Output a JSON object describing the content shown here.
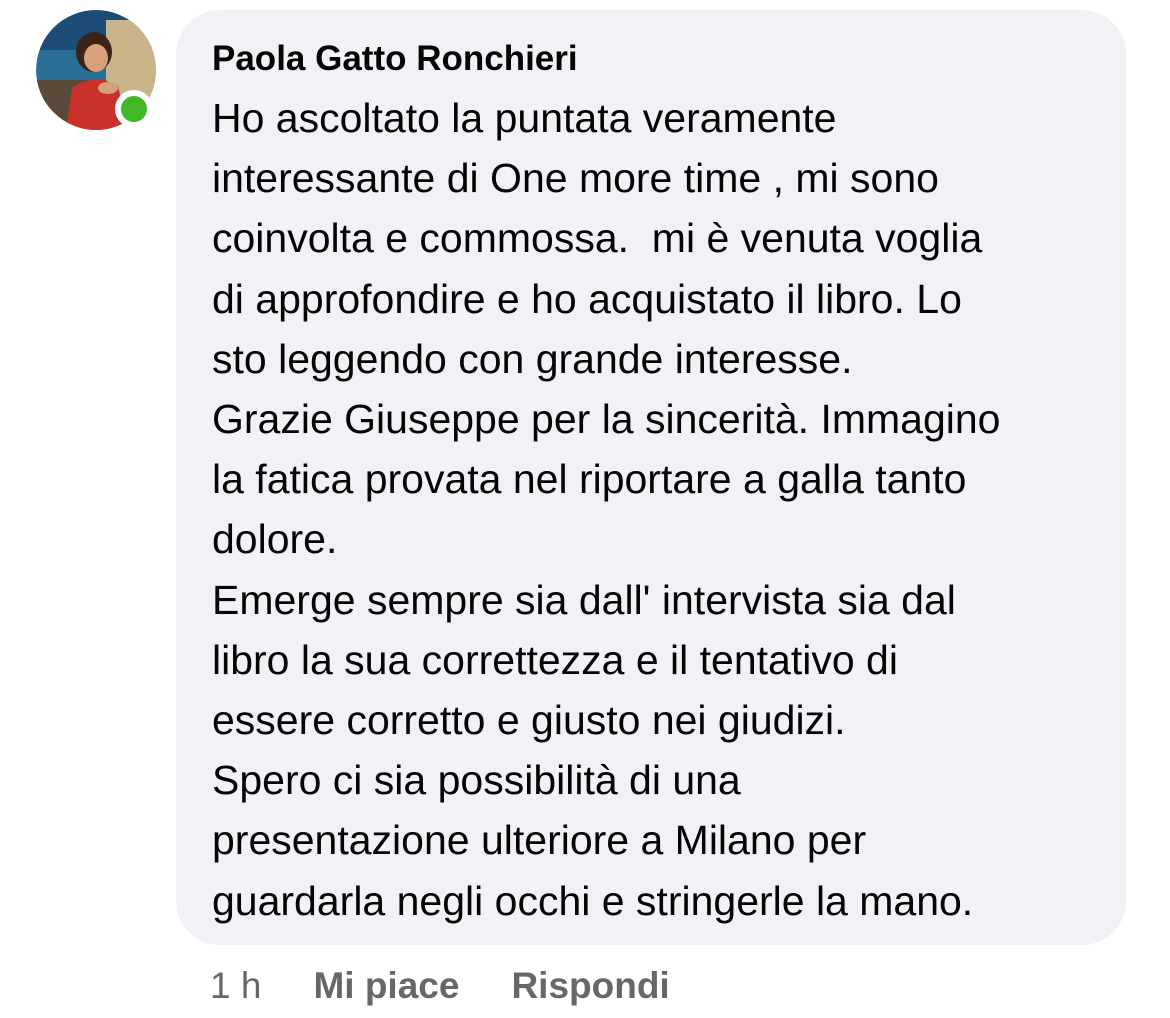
{
  "comment": {
    "author": "Paola Gatto Ronchieri",
    "lines": [
      "Ho ascoltato la puntata veramente",
      "interessante di One more time , mi sono",
      "coinvolta e commossa.  mi è venuta voglia",
      "di approfondire e ho acquistato il libro. Lo",
      "sto leggendo con grande interesse.",
      "Grazie Giuseppe per la sincerità. Immagino",
      "la fatica provata nel riportare a galla tanto",
      "dolore.",
      "Emerge sempre sia dall' intervista sia dal",
      "libro la sua correttezza e il tentativo di",
      "essere corretto e giusto nei giudizi.",
      "Spero ci sia possibilità di una",
      "presentazione ulteriore a Milano per",
      "guardarla negli occhi e stringerle la mano."
    ],
    "online_status_color": "#42b72a",
    "bubble_color": "#f0f2f5"
  },
  "actions": {
    "time": "1 h",
    "like_label": "Mi piace",
    "reply_label": "Rispondi"
  }
}
